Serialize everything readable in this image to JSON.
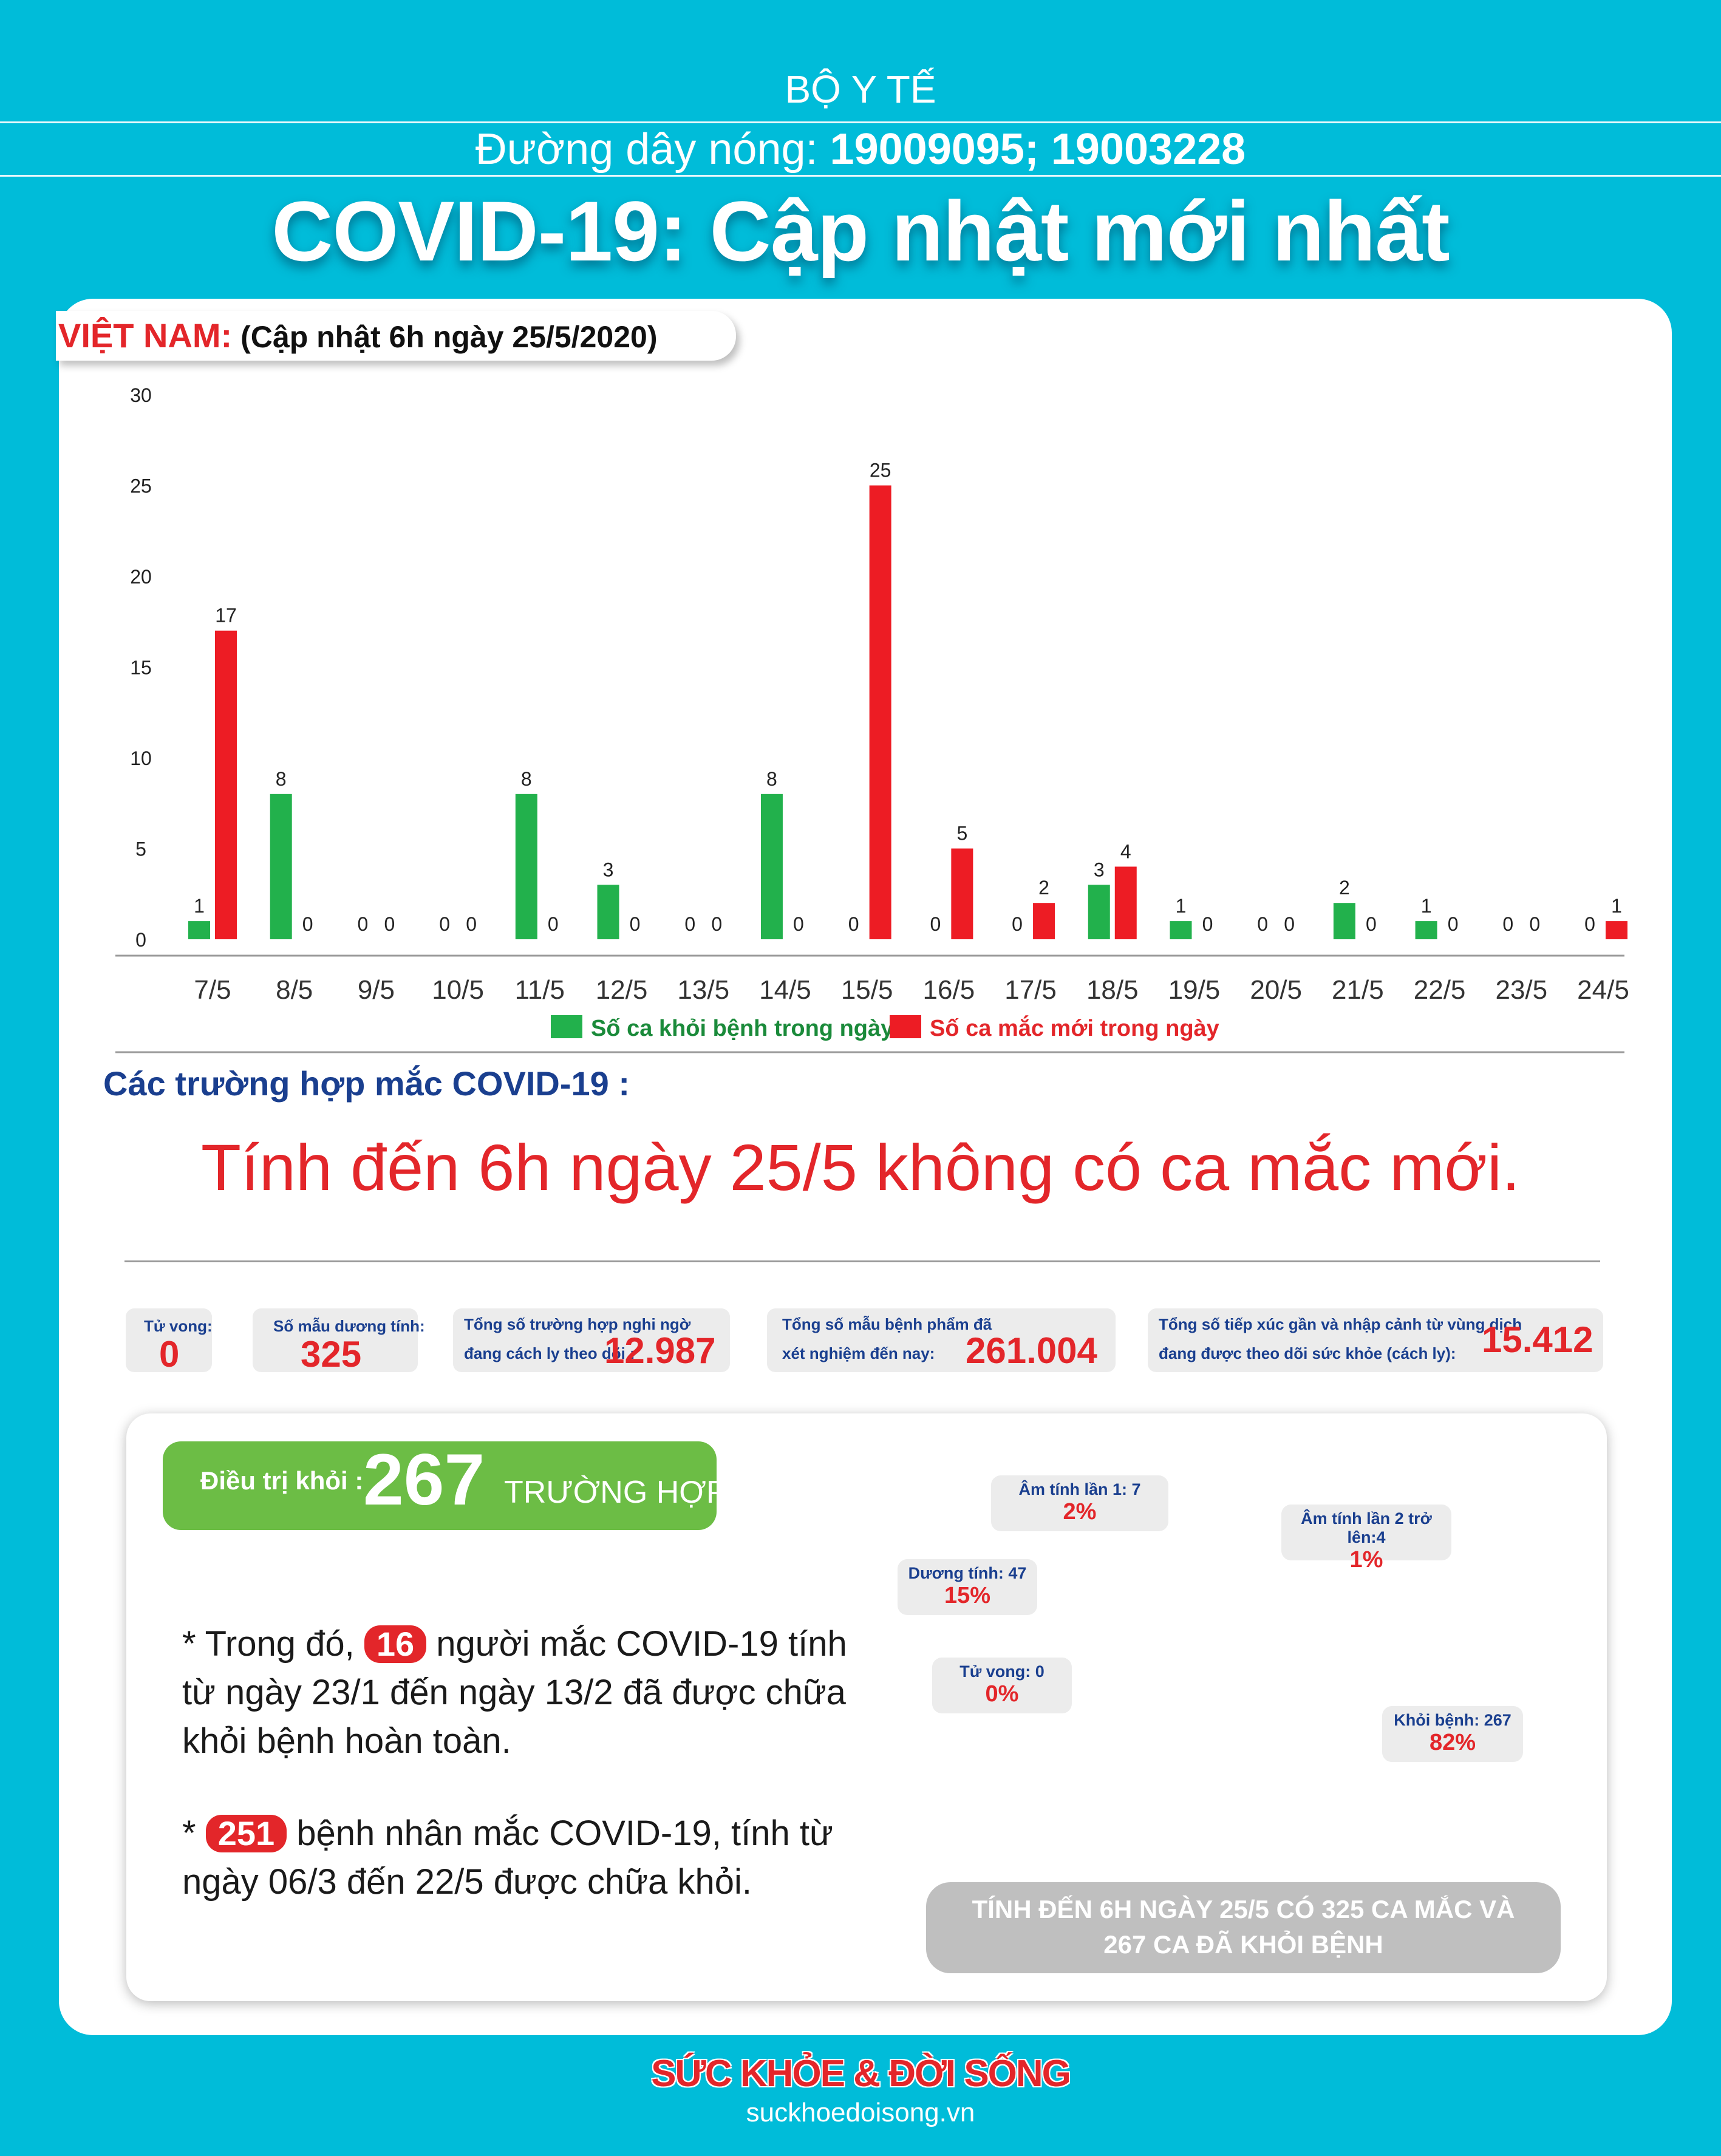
{
  "header": {
    "ministry": "BỘ Y TẾ",
    "hotline_label": "Đường dây nóng:",
    "hotline_numbers": "19009095; 19003228",
    "title": "COVID-19: Cập nhật mới nhất"
  },
  "vietnam": {
    "label": "VIỆT NAM:",
    "update": "(Cập nhật 6h ngày 25/5/2020)"
  },
  "chart_data": [
    {
      "type": "bar",
      "categories": [
        "7/5",
        "8/5",
        "9/5",
        "10/5",
        "11/5",
        "12/5",
        "13/5",
        "14/5",
        "15/5",
        "16/5",
        "17/5",
        "18/5",
        "19/5",
        "20/5",
        "21/5",
        "22/5",
        "23/5",
        "24/5"
      ],
      "series": [
        {
          "name": "Số ca khỏi bệnh trong ngày",
          "color": "#22b14c",
          "values": [
            1,
            8,
            0,
            0,
            8,
            3,
            0,
            8,
            0,
            0,
            0,
            3,
            1,
            0,
            2,
            1,
            0,
            0
          ]
        },
        {
          "name": "Số ca mắc mới trong ngày",
          "color": "#ed1c24",
          "values": [
            17,
            0,
            0,
            0,
            0,
            0,
            0,
            0,
            25,
            5,
            2,
            4,
            0,
            0,
            0,
            0,
            0,
            1
          ]
        }
      ],
      "yticks": [
        "0",
        "5",
        "10",
        "15",
        "20",
        "25",
        "30"
      ],
      "ylim": [
        0,
        30
      ],
      "legend": "bottom",
      "data_labels": true
    },
    {
      "type": "pie",
      "categories": [
        "Khỏi bệnh",
        "Dương tính",
        "Tử vong",
        "Âm tính lần 1",
        "Âm tính lần 2 trở lên"
      ],
      "values": [
        267,
        47,
        0,
        7,
        4
      ],
      "colors": [
        "#92cd50",
        "#e56b1f",
        "#999999",
        "#f5d327",
        "#4472c4"
      ]
    }
  ],
  "cases": {
    "section_title": "Các trường hợp mắc COVID-19 :",
    "headline": "Tính đến 6h ngày 25/5 không có ca mắc mới."
  },
  "stats": {
    "deaths_label": "Tử vong:",
    "deaths_value": "0",
    "positive_label": "Số mẫu dương tính:",
    "positive_value": "325",
    "suspected_label1": "Tổng số trường hợp nghi ngờ",
    "suspected_label2": "đang cách ly theo dõi :",
    "suspected_value": "12.987",
    "tested_label1": "Tổng số mẫu bệnh phẩm đã",
    "tested_label2": "xét nghiệm đến nay:",
    "tested_value": "261.004",
    "contacts_label1": "Tổng số tiếp xúc gần và nhập cảnh từ vùng dịch",
    "contacts_label2": "đang được theo dõi sức khỏe (cách ly):",
    "contacts_value": "15.412"
  },
  "recovered": {
    "label": "Điều trị khỏi :",
    "value": "267",
    "unit": "TRƯỜNG HỢP"
  },
  "notes": {
    "n1_prefix": "* Trong đó,",
    "n1_badge": "16",
    "n1_text1": "người mắc COVID-19 tính",
    "n1_text2": "từ ngày 23/1 đến ngày 13/2 đã được chữa",
    "n1_text3": "khỏi bệnh hoàn toàn.",
    "n2_prefix": "*",
    "n2_badge": "251",
    "n2_text1": "bệnh nhân  mắc COVID-19, tính từ",
    "n2_text2": "ngày 06/3 đến 22/5 được chữa khỏi."
  },
  "pie_labels": {
    "neg1_label": "Âm tính lần 1: 7",
    "neg1_pct": "2%",
    "neg2_label": "Âm tính lần 2 trở lên:4",
    "neg2_pct": "1%",
    "pos_label": "Dương tính: 47",
    "pos_pct": "15%",
    "death_label": "Tử vong: 0",
    "death_pct": "0%",
    "rec_label": "Khỏi bệnh: 267",
    "rec_pct": "82%"
  },
  "summary": {
    "line1": "TÍNH ĐẾN 6H NGÀY 25/5 CÓ 325 CA MẮC VÀ",
    "line2": "267 CA ĐÃ KHỎI BỆNH"
  },
  "footer": {
    "brand": "SỨC KHỎE & ĐỜI SỐNG",
    "site": "suckhoedoisong.vn"
  },
  "colors": {
    "background": "#00bcd9",
    "accent_red": "#e3262a",
    "accent_green": "#6cbd45",
    "navy": "#1a3f8f"
  }
}
